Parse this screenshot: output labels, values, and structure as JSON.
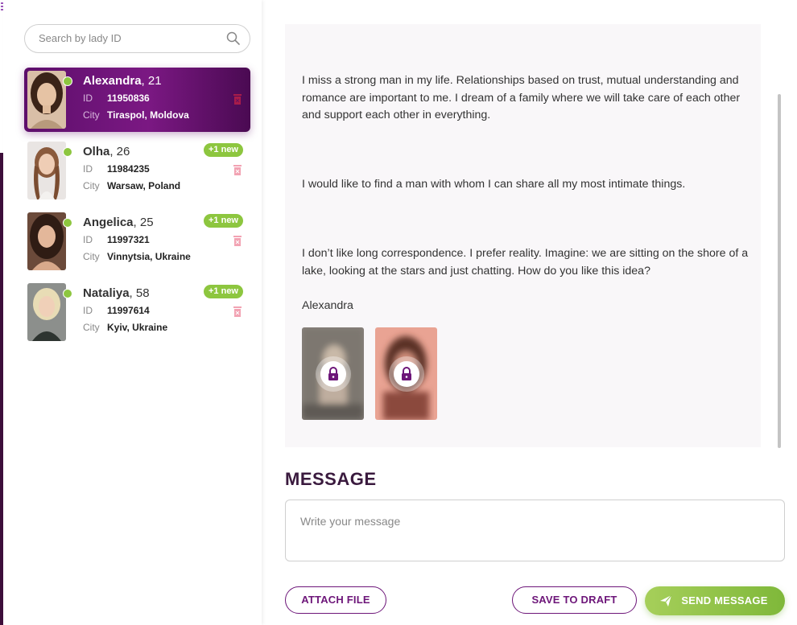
{
  "search": {
    "placeholder": "Search by lady ID"
  },
  "ladies": [
    {
      "name": "Alexandra",
      "age": ", 21",
      "id_label": "ID",
      "id": "11950836",
      "city_label": "City",
      "city": "Tiraspol, Moldova",
      "badge": "",
      "active": true
    },
    {
      "name": "Olha",
      "age": ", 26",
      "id_label": "ID",
      "id": "11984235",
      "city_label": "City",
      "city": "Warsaw, Poland",
      "badge": "+1 new",
      "active": false
    },
    {
      "name": "Angelica",
      "age": ", 25",
      "id_label": "ID",
      "id": "11997321",
      "city_label": "City",
      "city": "Vinnytsia, Ukraine",
      "badge": "+1 new",
      "active": false
    },
    {
      "name": "Nataliya",
      "age": ", 58",
      "id_label": "ID",
      "id": "11997614",
      "city_label": "City",
      "city": "Kyiv, Ukraine",
      "badge": "+1 new",
      "active": false
    }
  ],
  "letter": {
    "paragraphs": [
      "I miss a strong man in my life. Relationships based on trust, mutual understanding and romance are important to me. I dream of a family where we will take care of each other and support each other in everything.",
      "I would like to find a man with whom I can share all my most intimate things.",
      "I don’t like long correspondence. I prefer reality. Imagine: we are sitting on the shore of a lake, looking at the stars and just chatting. How do you like this idea?"
    ],
    "signature": "Alexandra",
    "photos": [
      "locked-photo",
      "locked-photo"
    ]
  },
  "composer": {
    "title": "MESSAGE",
    "placeholder": "Write your message",
    "attach_label": "ATTACH FILE",
    "draft_label": "SAVE TO DRAFT",
    "send_label": "SEND MESSAGE"
  },
  "colors": {
    "brand_purple": "#6d1679",
    "active_card": "#7b1883",
    "online_green": "#8dc63f",
    "send_green": "#8fc346",
    "trash_pink": "#f2a3b3"
  },
  "icons": {
    "collapse": "collapse-sidebar-icon",
    "search": "search-icon",
    "trash": "trash-icon",
    "lock": "lock-icon",
    "send": "paper-plane-icon"
  }
}
